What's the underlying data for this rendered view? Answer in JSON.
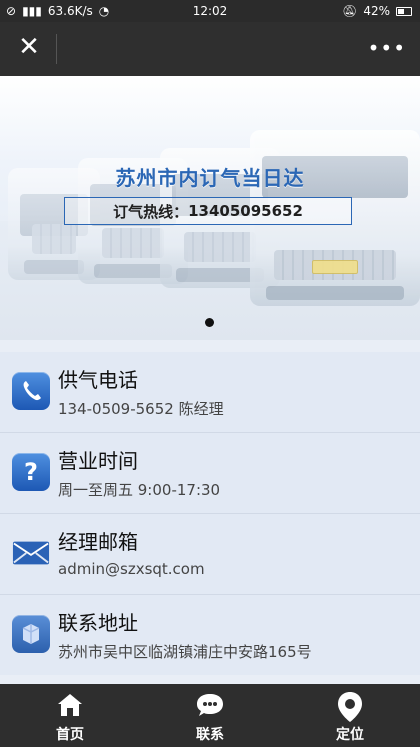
{
  "status_bar": {
    "network_speed": "63.6K/s",
    "time": "12:02",
    "battery": "42%"
  },
  "top_bar": {
    "close_label": "✕",
    "more_label": "•••"
  },
  "banner": {
    "title": "苏州市内订气当日达",
    "hotline_label": "订气热线：",
    "hotline_number": "13405095652"
  },
  "contact_list": {
    "items": [
      {
        "title": "供气电话",
        "detail": "134-0509-5652 陈经理",
        "icon": "phone-icon"
      },
      {
        "title": "营业时间",
        "detail": "周一至周五 9:00-17:30",
        "icon": "question-icon"
      },
      {
        "title": "经理邮箱",
        "detail": "admin@szxsqt.com",
        "icon": "mail-icon"
      },
      {
        "title": "联系地址",
        "detail": "苏州市吴中区临湖镇浦庄中安路165号",
        "icon": "location-icon"
      }
    ]
  },
  "tab_bar": {
    "tabs": [
      {
        "label": "首页",
        "icon": "home-icon"
      },
      {
        "label": "联系",
        "icon": "chat-icon"
      },
      {
        "label": "定位",
        "icon": "location-pin-icon"
      }
    ]
  },
  "colors": {
    "brand_blue": "#2b67b5",
    "icon_blue": "#1d58b4",
    "tab_bg": "#2e2e2e",
    "list_bg": "#e2e9f4"
  }
}
